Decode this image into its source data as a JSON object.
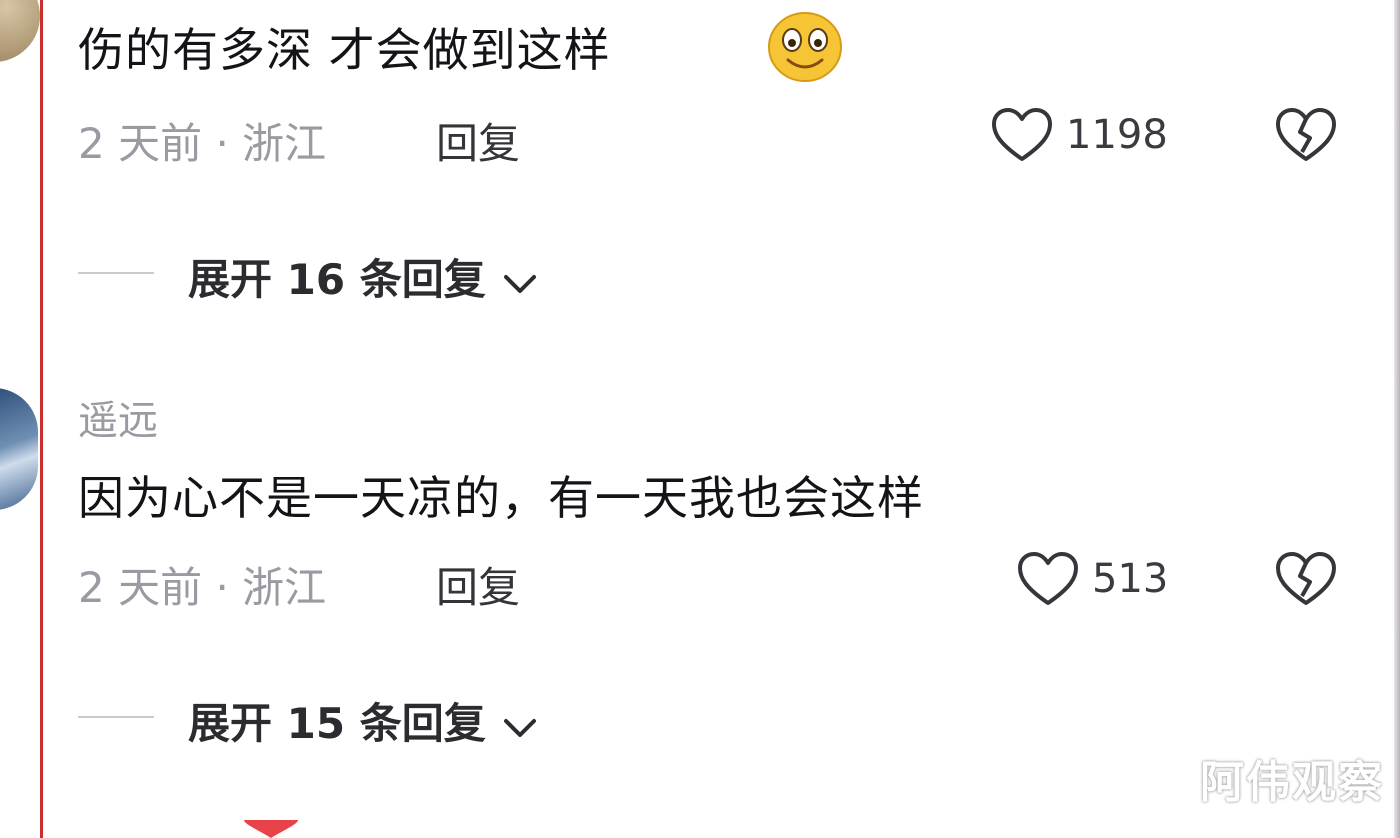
{
  "comments": [
    {
      "text": "伤的有多深 才会做到这样",
      "emoji": "smiley-emoji",
      "time": "2 天前",
      "location_sep": "·",
      "location": "浙江",
      "reply_label": "回复",
      "like_count": "1198",
      "expand_label": "展开 16 条回复"
    },
    {
      "username": "遥远",
      "text": "因为心不是一天凉的，有一天我也会这样",
      "time": "2 天前",
      "location_sep": "·",
      "location": "浙江",
      "reply_label": "回复",
      "like_count": "513",
      "expand_label": "展开 15 条回复"
    }
  ],
  "watermark": "阿伟观察",
  "colors": {
    "frame_line": "#c8302f",
    "meta_gray": "#9a9aa2",
    "text_dark": "#141418"
  },
  "icons": {
    "like": "heart-outline-icon",
    "dislike": "broken-heart-icon",
    "expand": "chevron-down-icon"
  }
}
